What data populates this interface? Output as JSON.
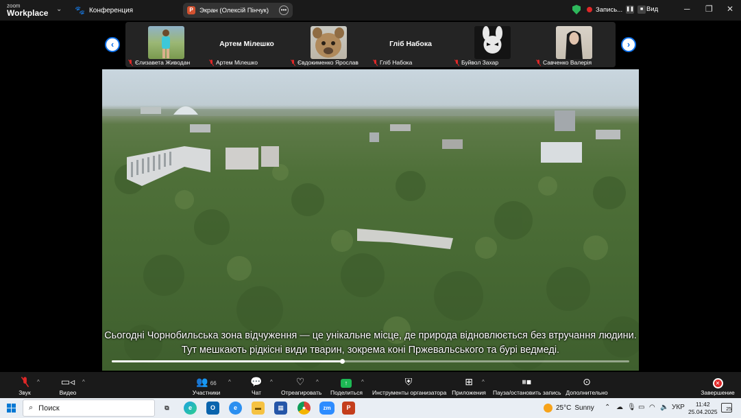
{
  "titlebar": {
    "brand_line1": "zoom",
    "brand_line2": "Workplace",
    "conference_label": "Конференция",
    "share_pill_label": "Экран (Олексій Пінчук)",
    "recording_label": "Запись...",
    "view_label": "Вид"
  },
  "participants": [
    {
      "name": "Єлизавета Живодан",
      "display": "photo"
    },
    {
      "name": "Артем Мілешко",
      "big_name": "Артем Мілешко",
      "display": "name"
    },
    {
      "name": "Євдокименко Ярослав",
      "display": "photo"
    },
    {
      "name": "Гліб Набока",
      "big_name": "Гліб Набока",
      "display": "name"
    },
    {
      "name": "Буйвол Захар",
      "display": "photo"
    },
    {
      "name": "Савченко Валерія",
      "display": "photo"
    }
  ],
  "content": {
    "subtitle_line1": "Сьогодні Чорнобильська зона відчуження — це унікальне місце, де природа відновлюється без втручання людини.",
    "subtitle_line2": "Тут мешкають рідкісні види тварин, зокрема коні Пржевальського та бурі ведмеді.",
    "video_progress": 0.445
  },
  "toolbar": {
    "audio": "Звук",
    "video": "Видео",
    "participants": "Участники",
    "participants_count": "66",
    "chat": "Чат",
    "react": "Отреагировать",
    "share": "Поделиться",
    "host_tools": "Инструменты организатора",
    "apps": "Приложения",
    "pause_recording": "Пауза/остановить запись",
    "more": "Дополнительно",
    "end": "Завершение"
  },
  "taskbar": {
    "search_placeholder": "Поиск",
    "weather_temp": "25°C",
    "weather_text": "Sunny",
    "language": "УКР",
    "time": "11:42",
    "date": "25.04.2025",
    "notifications": "25"
  },
  "colors": {
    "accent_blue": "#0e71eb",
    "muted_red": "#e02828",
    "share_green": "#1db954"
  }
}
